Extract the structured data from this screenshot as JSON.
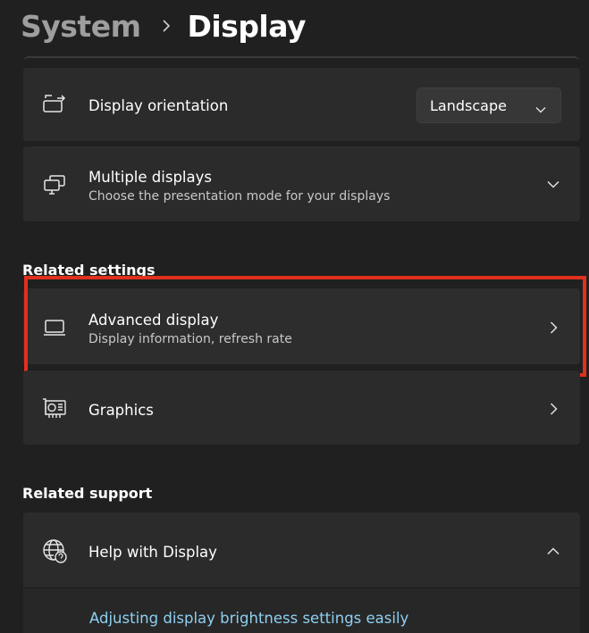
{
  "breadcrumb": {
    "parent": "System",
    "current": "Display"
  },
  "orientation": {
    "title": "Display orientation",
    "value": "Landscape"
  },
  "multiple_displays": {
    "title": "Multiple displays",
    "description": "Choose the presentation mode for your displays"
  },
  "related_settings": {
    "heading": "Related settings",
    "advanced_display": {
      "title": "Advanced display",
      "description": "Display information, refresh rate"
    },
    "graphics": {
      "title": "Graphics"
    }
  },
  "related_support": {
    "heading": "Related support",
    "help": {
      "title": "Help with Display",
      "link": "Adjusting display brightness settings easily"
    }
  },
  "colors": {
    "background": "#202020",
    "card": "#2b2b2b",
    "highlight": "#e0301e",
    "link": "#8ed0f2"
  }
}
